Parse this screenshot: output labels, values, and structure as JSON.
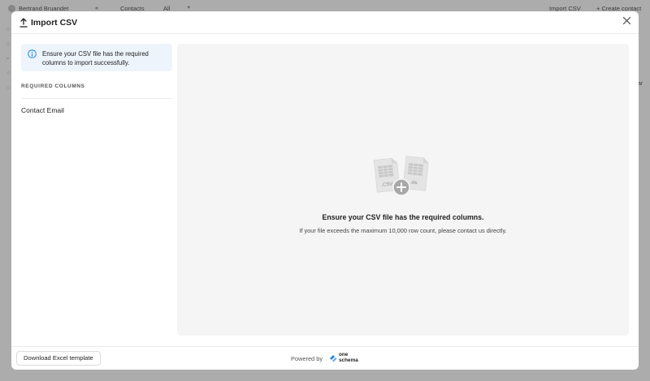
{
  "app": {
    "user_name": "Bertrand Bruandet",
    "collapse_glyph": "«",
    "tab_contacts": "Contacts",
    "tab_all": "All",
    "tab_add": "+",
    "import_csv": "Import CSV",
    "create_contact": "+ Create contact",
    "right_fragment": "ar"
  },
  "modal": {
    "title": "Import CSV",
    "icons": {
      "header": "upload-icon",
      "close": "close-icon",
      "info": "info-icon"
    },
    "info_text": "Ensure your CSV file has the required columns to import successfully.",
    "required_label": "REQUIRED COLUMNS",
    "required_columns": [
      "Contact Email"
    ],
    "dropzone": {
      "illus_csv": ".CSV",
      "illus_xls": ".xls",
      "title": "Ensure your CSV file has the required columns.",
      "subtitle": "If your file exceeds the maximum 10,000 row count, please contact us directly."
    },
    "footer": {
      "download_label": "Download Excel template",
      "powered_by": "Powered by",
      "brand_line1": "one",
      "brand_line2": "schema"
    }
  },
  "colors": {
    "accent": "#1e88e5",
    "info_bg": "#eef4fb",
    "dropzone_bg": "#f5f5f5"
  }
}
